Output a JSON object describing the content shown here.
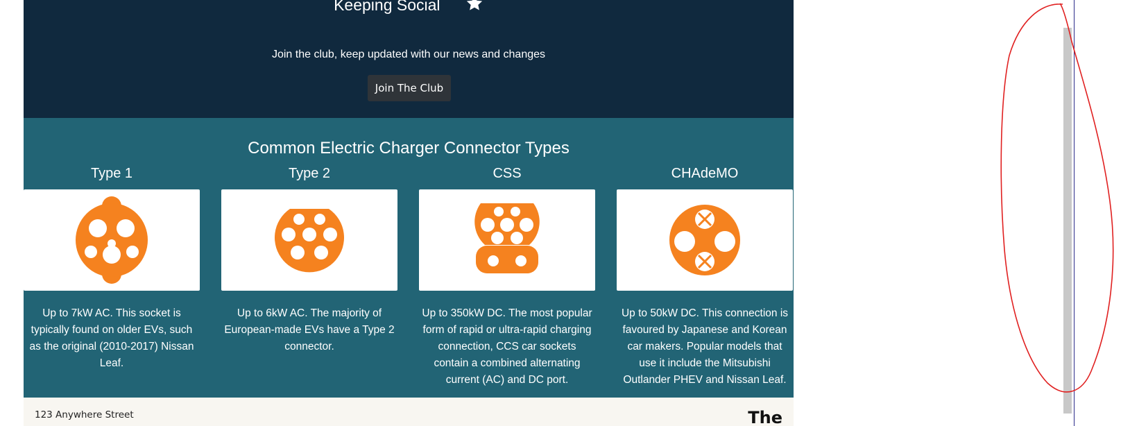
{
  "social": {
    "heading": "Keeping Social",
    "text": "Join the club, keep updated with our news and changes",
    "button_label": "Join The Club"
  },
  "connectors": {
    "title": "Common Electric Charger Connector Types",
    "items": [
      {
        "name": "Type 1",
        "icon": "type1-connector-icon",
        "description": "Up to 7kW AC. This socket is typically found on older EVs, such as the original (2010-2017) Nissan Leaf."
      },
      {
        "name": "Type 2",
        "icon": "type2-connector-icon",
        "description": "Up to 6kW AC. The majority of European-made EVs have a Type 2 connector."
      },
      {
        "name": "CSS",
        "icon": "ccs-connector-icon",
        "description": "Up to 350kW DC. The most popular form of rapid or ultra-rapid charging connection, CCS car sockets contain a combined alternating current (AC) and DC port."
      },
      {
        "name": "CHAdeMO",
        "icon": "chademo-connector-icon",
        "description": "Up to 50kW DC. This connection is favoured by Japanese and Korean car makers. Popular models that use it include the Mitsubishi Outlander PHEV and Nissan Leaf."
      }
    ]
  },
  "footer": {
    "address": "123 Anywhere Street",
    "title_partial": "The"
  },
  "colors": {
    "social_bg": "#10293e",
    "connectors_bg": "#226475",
    "connector_orange": "#f5821f",
    "footer_bg": "#f8f6f1",
    "annotation_red": "#e02020"
  }
}
